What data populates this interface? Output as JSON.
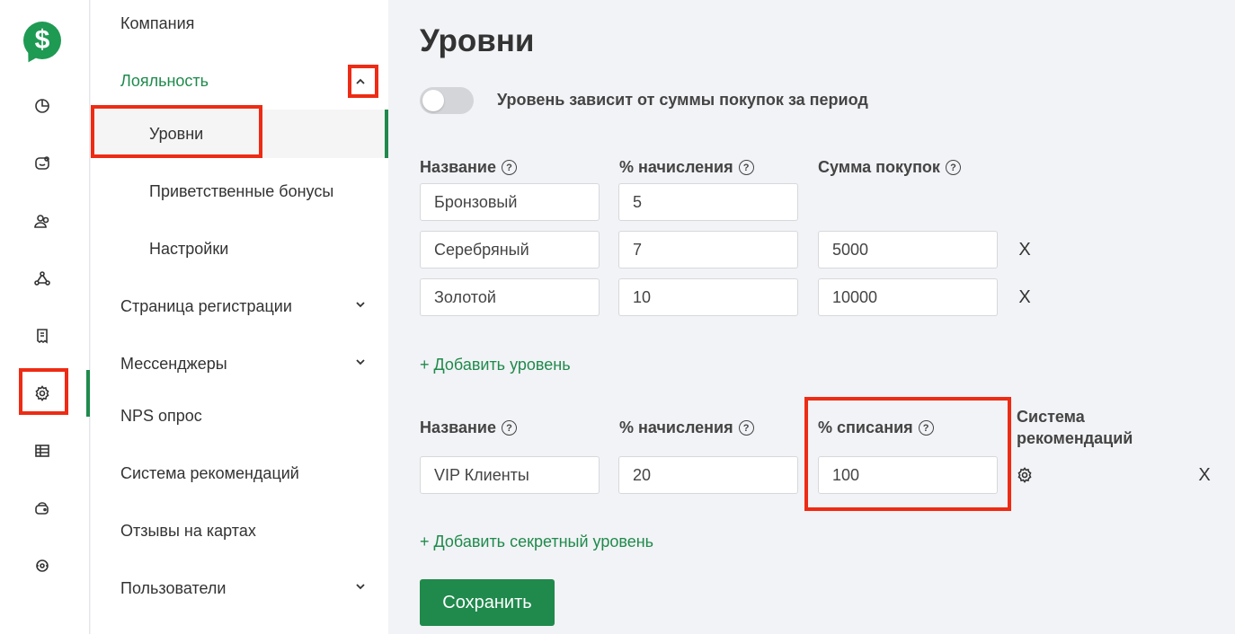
{
  "rail": {
    "logo_glyph": "$",
    "icons": [
      "analytics-icon",
      "chat-icon",
      "users-icon",
      "network-icon",
      "receipt-icon",
      "gear-icon",
      "table-icon",
      "wallet-icon",
      "refresh-icon"
    ],
    "active_icon": "gear-icon"
  },
  "nav": {
    "company": "Компания",
    "loyalty": "Лояльность",
    "levels": "Уровни",
    "welcome_bonuses": "Приветственные бонусы",
    "settings": "Настройки",
    "registration_page": "Страница регистрации",
    "messengers": "Мессенджеры",
    "nps": "NPS опрос",
    "referral": "Система рекомендаций",
    "map_reviews": "Отзывы на картах",
    "users": "Пользователи"
  },
  "main": {
    "title": "Уровни",
    "toggle_label": "Уровень зависит от суммы покупок за период",
    "toggle_on": false,
    "levels_headers": {
      "name": "Название",
      "accrual": "% начисления",
      "purchase_sum": "Сумма покупок"
    },
    "levels": [
      {
        "name": "Бронзовый",
        "accrual": "5",
        "purchase_sum": ""
      },
      {
        "name": "Серебряный",
        "accrual": "7",
        "purchase_sum": "5000"
      },
      {
        "name": "Золотой",
        "accrual": "10",
        "purchase_sum": "10000"
      }
    ],
    "add_level": "+ Добавить уровень",
    "secret_headers": {
      "name": "Название",
      "accrual": "% начисления",
      "writeoff": "% списания",
      "referral": "Система рекомендаций"
    },
    "secret_levels": [
      {
        "name": "VIP Клиенты",
        "accrual": "20",
        "writeoff": "100"
      }
    ],
    "add_secret_level": "+ Добавить секретный уровень",
    "save": "Сохранить",
    "remove_glyph": "X",
    "help_glyph": "?"
  },
  "colors": {
    "accent": "#1f8a4c",
    "highlight": "#ee2b14"
  }
}
